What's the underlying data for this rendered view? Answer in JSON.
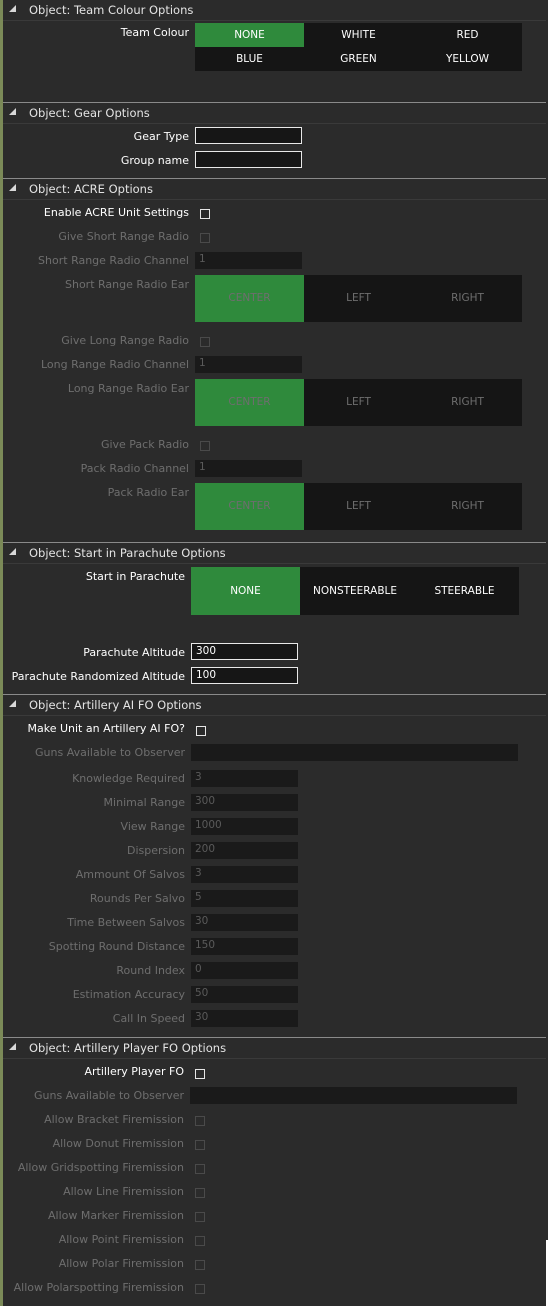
{
  "sections": {
    "team": {
      "title": "Object: Team Colour Options",
      "label": "Team Colour",
      "options": [
        "NONE",
        "WHITE",
        "RED",
        "BLUE",
        "GREEN",
        "YELLOW"
      ],
      "selected": "NONE"
    },
    "gear": {
      "title": "Object: Gear Options",
      "gear_type_label": "Gear Type",
      "gear_type_value": "",
      "group_name_label": "Group name",
      "group_name_value": ""
    },
    "acre": {
      "title": "Object: ACRE Options",
      "enable_label": "Enable ACRE Unit Settings",
      "short_radio_label": "Give Short Range Radio",
      "short_channel_label": "Short Range Radio Channel",
      "short_channel_value": "1",
      "short_ear_label": "Short Range Radio Ear",
      "long_radio_label": "Give Long Range Radio",
      "long_channel_label": "Long Range Radio Channel",
      "long_channel_value": "1",
      "long_ear_label": "Long Range Radio Ear",
      "pack_radio_label": "Give Pack Radio",
      "pack_channel_label": "Pack Radio Channel",
      "pack_channel_value": "1",
      "pack_ear_label": "Pack Radio Ear",
      "ear_options": [
        "CENTER",
        "LEFT",
        "RIGHT"
      ],
      "ear_selected": "CENTER"
    },
    "parachute": {
      "title": "Object: Start in Parachute Options",
      "start_label": "Start in Parachute",
      "options": [
        "NONE",
        "NONSTEERABLE",
        "STEERABLE"
      ],
      "selected": "NONE",
      "altitude_label": "Parachute Altitude",
      "altitude_value": "300",
      "random_label": "Parachute Randomized Altitude",
      "random_value": "100"
    },
    "artillery_ai": {
      "title": "Object: Artillery AI FO Options",
      "make_label": "Make Unit an Artillery AI FO?",
      "guns_label": "Guns Available to Observer",
      "guns_value": "",
      "fields": [
        {
          "label": "Knowledge Required",
          "value": "3"
        },
        {
          "label": "Minimal Range",
          "value": "300"
        },
        {
          "label": "View Range",
          "value": "1000"
        },
        {
          "label": "Dispersion",
          "value": "200"
        },
        {
          "label": "Ammount Of Salvos",
          "value": "3"
        },
        {
          "label": "Rounds Per Salvo",
          "value": "5"
        },
        {
          "label": "Time Between Salvos",
          "value": "30"
        },
        {
          "label": "Spotting Round Distance",
          "value": "150"
        },
        {
          "label": "Round Index",
          "value": "0"
        },
        {
          "label": "Estimation Accuracy",
          "value": "50"
        },
        {
          "label": "Call In Speed",
          "value": "30"
        }
      ]
    },
    "artillery_player": {
      "title": "Object: Artillery Player FO Options",
      "fo_label": "Artillery Player FO",
      "guns_label": "Guns Available to Observer",
      "guns_value": "",
      "checks": [
        "Allow Bracket Firemission",
        "Allow Donut Firemission",
        "Allow Gridspotting Firemission",
        "Allow Line Firemission",
        "Allow Marker Firemission",
        "Allow Point Firemission",
        "Allow Polar Firemission",
        "Allow Polarspotting Firemission"
      ]
    }
  },
  "colors": {
    "background": "#2b2b2b",
    "selected": "#2f8a3c",
    "option_bg": "#151515",
    "disabled_text": "#6e6e6e"
  }
}
